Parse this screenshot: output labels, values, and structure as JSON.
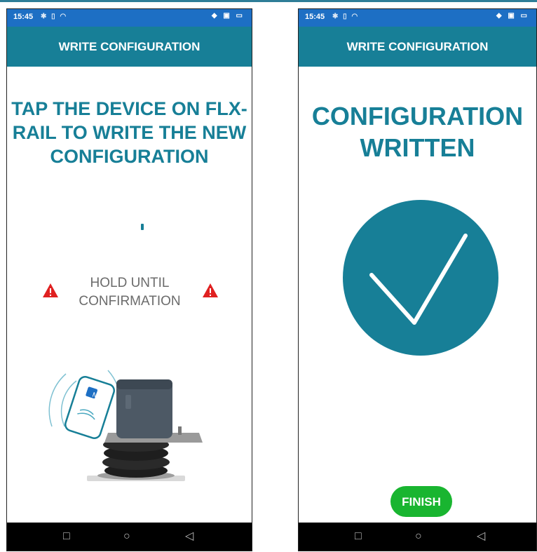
{
  "screens": [
    {
      "status": {
        "time": "15:45",
        "left_icons": "✱ ▯ ◠",
        "right_icons": "◆ ▣ ▭"
      },
      "app_title": "WRITE CONFIGURATION",
      "instruction": "TAP THE DEVICE ON FLX-RAIL TO WRITE THE NEW CONFIGURATION",
      "hold_text": "HOLD UNTIL CONFIRMATION",
      "icons": {
        "warning": "warning-triangle-icon",
        "nfc": "nfc-icon"
      },
      "nav": {
        "back": "◁",
        "home": "○",
        "recents": "□"
      }
    },
    {
      "status": {
        "time": "15:45",
        "left_icons": "✱ ▯ ◠",
        "right_icons": "◆ ▣ ▭"
      },
      "app_title": "WRITE CONFIGURATION",
      "title": "CONFIGURATION WRITTEN",
      "finish_label": "FINISH",
      "icons": {
        "check": "checkmark-icon"
      },
      "nav": {
        "back": "◁",
        "home": "○",
        "recents": "□"
      }
    }
  ],
  "colors": {
    "status_bar": "#1d6fc4",
    "app_bar": "#177f97",
    "accent_text": "#177f97",
    "warning": "#e02020",
    "success_button": "#19b530",
    "check_circle": "#177f97",
    "nav_bar": "#000000"
  }
}
